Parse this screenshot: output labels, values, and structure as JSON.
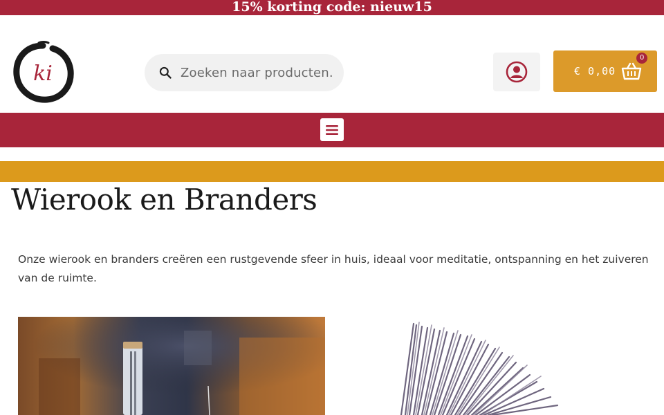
{
  "promo": {
    "text": "15% korting code: nieuw15"
  },
  "header": {
    "logo_text": "ki",
    "search": {
      "placeholder": "Zoeken naar producten.."
    },
    "cart": {
      "total": "€ 0,00",
      "count": "0"
    }
  },
  "colors": {
    "brand_red": "#a8253a",
    "gold": "#dc9a1c",
    "cart_bg": "#dc9a2a"
  },
  "page": {
    "title": "Wierook en Branders",
    "intro": "Onze wierook en branders creëren een rustgevende sfeer in huis, ideaal voor meditatie, ontspanning en het zuiveren van de ruimte."
  },
  "icons": {
    "search": "search-icon",
    "account": "user-circle-icon",
    "cart": "shopping-basket-icon",
    "menu": "hamburger-menu-icon"
  }
}
